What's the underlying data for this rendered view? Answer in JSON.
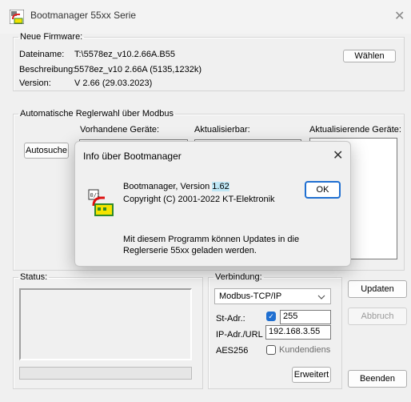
{
  "window": {
    "title": "Bootmanager 55xx Serie",
    "close_glyph": "✕"
  },
  "firmware": {
    "legend": "Neue Firmware:",
    "filename_label": "Dateiname:",
    "filename_value": "T:\\5578ez_v10.2.66A.B55",
    "choose_button": "Wählen",
    "description_label": "Beschreibung:",
    "description_value": "5578ez_v10 2.66A (5135,1232k)",
    "version_label": "Version:",
    "version_value": "V 2.66 (29.03.2023)"
  },
  "modbus": {
    "legend": "Automatische Reglerwahl über Modbus",
    "available_label": "Vorhandene Geräte:",
    "updatable_label": "Aktualisierbar:",
    "updating_label": "Aktualisierende Geräte:",
    "autosearch_button": "Autosuche"
  },
  "status": {
    "legend": "Status:"
  },
  "connection": {
    "legend": "Verbindung:",
    "protocol_value": "Modbus-TCP/IP",
    "st_addr_label": "St-Adr.:",
    "st_addr_checked": true,
    "st_addr_value": "255",
    "ip_label": "IP-Adr./URL",
    "ip_value": "192.168.3.55",
    "aes_label": "AES256",
    "aes_checkbox_label": "Kundendiens",
    "aes_checked": false,
    "extended_button": "Erweitert"
  },
  "actions": {
    "update_button": "Updaten",
    "abort_button": "Abbruch",
    "exit_button": "Beenden"
  },
  "dialog": {
    "title": "Info über Bootmanager",
    "close_glyph": "✕",
    "product_prefix": "Bootmanager, Version ",
    "version_highlight": "1.62",
    "copyright": "Copyright (C) 2001-2022  KT-Elektronik",
    "ok_button": "OK",
    "description_line1": "Mit diesem Programm können Updates in die",
    "description_line2": "Reglerserie 55xx geladen werden."
  },
  "colors": {
    "accent": "#1f6fd1",
    "highlight": "#bfe7f5"
  },
  "icons": {
    "app": "bootmanager-app-icon",
    "chevron": "chevron-down-icon",
    "check": "checkmark-icon"
  }
}
